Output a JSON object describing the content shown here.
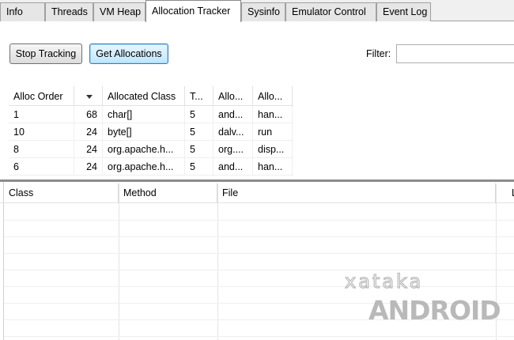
{
  "tabs": [
    {
      "label": "Info",
      "active": false
    },
    {
      "label": "Threads",
      "active": false
    },
    {
      "label": "VM Heap",
      "active": false
    },
    {
      "label": "Allocation Tracker",
      "active": true
    },
    {
      "label": "Sysinfo",
      "active": false
    },
    {
      "label": "Emulator Control",
      "active": false
    },
    {
      "label": "Event Log",
      "active": false
    }
  ],
  "toolbar": {
    "stop_tracking_label": "Stop Tracking",
    "get_allocations_label": "Get Allocations",
    "filter_label": "Filter:",
    "filter_value": ""
  },
  "alloc_table": {
    "headers": [
      "Alloc Order",
      "",
      "Allocated Class",
      "T...",
      "Allo...",
      "Allo..."
    ],
    "rows": [
      [
        "1",
        "68",
        "char[]",
        "5",
        "and...",
        "han..."
      ],
      [
        "10",
        "24",
        "byte[]",
        "5",
        "dalv...",
        "run"
      ],
      [
        "8",
        "24",
        "org.apache.h...",
        "5",
        "org....",
        "disp..."
      ],
      [
        "6",
        "24",
        "org.apache.h...",
        "5",
        "and...",
        "han..."
      ]
    ]
  },
  "trace_table": {
    "headers": [
      "Class",
      "Method",
      "File",
      "L"
    ]
  },
  "watermark": {
    "line1": "xataka",
    "line2": "ANDROID"
  },
  "colors": {
    "focus_accent": "#3c7fb1",
    "splitter": "#8c8c8c",
    "watermark": "#b9b9b9"
  }
}
